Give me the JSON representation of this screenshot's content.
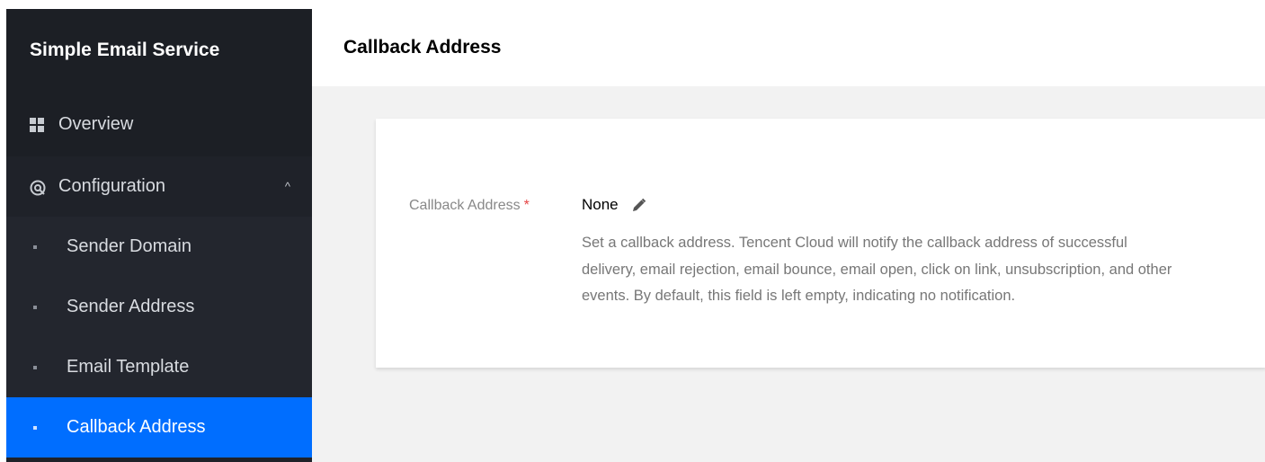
{
  "sidebar": {
    "title": "Simple Email Service",
    "items": [
      {
        "label": "Overview",
        "icon": "grid-icon"
      },
      {
        "label": "Configuration",
        "icon": "settings-circle-icon",
        "expanded": true
      }
    ],
    "sub_items": [
      {
        "label": "Sender Domain"
      },
      {
        "label": "Sender Address"
      },
      {
        "label": "Email Template"
      },
      {
        "label": "Callback Address",
        "active": true
      }
    ]
  },
  "header": {
    "title": "Callback Address"
  },
  "form": {
    "label": "Callback Address",
    "required_mark": "*",
    "value": "None",
    "edit_icon": "pencil-icon",
    "description": "Set a callback address. Tencent Cloud will notify the callback address of successful delivery, email rejection, email bounce, email open, click on link, unsubscription, and other events. By default, this field is left empty, indicating no notification."
  },
  "colors": {
    "sidebar_bg": "#1f2229",
    "active_item": "#006eff",
    "required": "#e54545",
    "main_bg": "#f2f2f2"
  }
}
